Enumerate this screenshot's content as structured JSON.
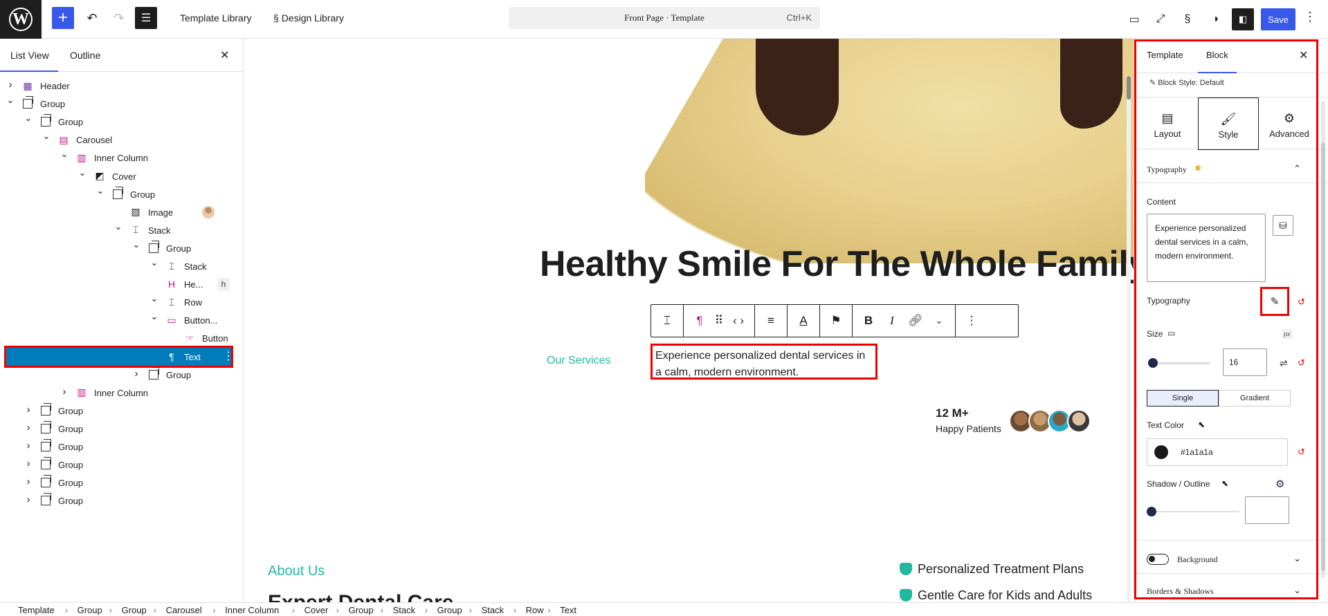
{
  "topbar": {
    "template_library": "Template Library",
    "design_library": "Design Library",
    "command_title": "Front Page · Template",
    "command_shortcut": "Ctrl+K",
    "save": "Save"
  },
  "listview": {
    "tab_list": "List View",
    "tab_outline": "Outline",
    "items": [
      {
        "label": "Header"
      },
      {
        "label": "Group"
      },
      {
        "label": "Group"
      },
      {
        "label": "Carousel"
      },
      {
        "label": "Inner Column"
      },
      {
        "label": "Cover"
      },
      {
        "label": "Group"
      },
      {
        "label": "Image"
      },
      {
        "label": "Stack"
      },
      {
        "label": "Group"
      },
      {
        "label": "Stack"
      },
      {
        "label": "He...",
        "badge": "h"
      },
      {
        "label": "Row"
      },
      {
        "label": "Button..."
      },
      {
        "label": "Button"
      },
      {
        "label": "Text"
      },
      {
        "label": "Group"
      },
      {
        "label": "Inner Column"
      },
      {
        "label": "Group"
      },
      {
        "label": "Group"
      },
      {
        "label": "Group"
      },
      {
        "label": "Group"
      },
      {
        "label": "Group"
      },
      {
        "label": "Group"
      }
    ]
  },
  "canvas": {
    "heading": "Healthy Smile For The Whole Family",
    "services_link": "Our Services",
    "paragraph": "Experience personalized dental services in a calm, modern environment.",
    "stats_number": "12 M+",
    "stats_label": "Happy Patients",
    "about_label": "About Us",
    "about_heading": "Expert Dental Care",
    "features": [
      "Personalized Treatment Plans",
      "Gentle Care for Kids and Adults"
    ]
  },
  "sidebar": {
    "tab_template": "Template",
    "tab_block": "Block",
    "block_style": "Block Style: Default",
    "seg_layout": "Layout",
    "seg_style": "Style",
    "seg_advanced": "Advanced",
    "typography_panel": "Typography",
    "content_label": "Content",
    "content_value": "Experience personalized dental services in a calm, modern environment.",
    "typography_label": "Typography",
    "size_label": "Size",
    "size_value": "16",
    "size_unit": "px",
    "single": "Single",
    "gradient": "Gradient",
    "text_color_label": "Text Color",
    "text_color_value": "#1a1a1a",
    "shadow_label": "Shadow / Outline",
    "background_label": "Background",
    "borders_label": "Borders & Shadows"
  },
  "breadcrumb": [
    "Template",
    "Group",
    "Group",
    "Carousel",
    "Inner Column",
    "Cover",
    "Group",
    "Stack",
    "Group",
    "Stack",
    "Row",
    "Text"
  ],
  "colors": {
    "accent": "#3858e9",
    "selection": "#007cba",
    "highlight": "#ee0000",
    "teal": "#22b8a0"
  }
}
